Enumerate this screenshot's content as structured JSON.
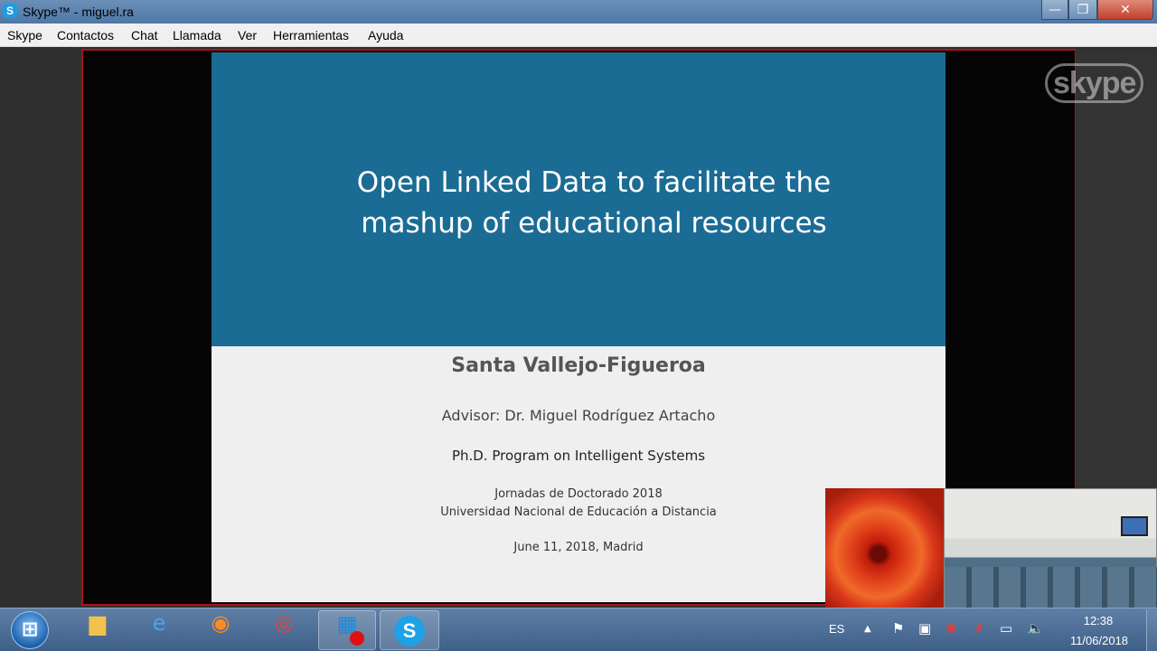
{
  "window": {
    "title": "Skype™ - miguel.ra",
    "minimize_glyph": "—",
    "maximize_glyph": "❐",
    "close_glyph": "✕"
  },
  "menu": [
    "Skype",
    "Contactos",
    "Chat",
    "Llamada",
    "Ver",
    "Herramientas",
    "Ayuda"
  ],
  "slide": {
    "title_line1": "Open Linked Data to facilitate the",
    "title_line2": "mashup of educational resources",
    "author": "Santa Vallejo-Figueroa",
    "advisor": "Advisor: Dr. Miguel Rodríguez Artacho",
    "program": "Ph.D. Program on Intelligent Systems",
    "event": "Jornadas de Doctorado 2018",
    "university": "Universidad  Nacional de Educación a Distancia",
    "date": "June 11, 2018, Madrid"
  },
  "watermark": "skype",
  "taskbar": {
    "start_glyph": "⊞",
    "apps": [
      {
        "name": "explorer",
        "icon": "folder-icon",
        "glyph": "▆"
      },
      {
        "name": "internet-explorer",
        "icon": "ie-icon",
        "glyph": "e"
      },
      {
        "name": "firefox",
        "icon": "firefox-icon",
        "glyph": "◉"
      },
      {
        "name": "chrome",
        "icon": "chrome-icon",
        "glyph": "◎"
      },
      {
        "name": "metro",
        "icon": "tiles-icon",
        "glyph": "▦"
      },
      {
        "name": "skype",
        "icon": "skype-icon",
        "glyph": "S"
      }
    ],
    "tray": {
      "language": "ES",
      "up_arrow": "▲",
      "flag": "⚑",
      "network": "▣",
      "tools": "✱",
      "security": "✗",
      "display": "▭",
      "volume": "🔈"
    },
    "clock_time": "12:38",
    "clock_date": "11/06/2018"
  }
}
